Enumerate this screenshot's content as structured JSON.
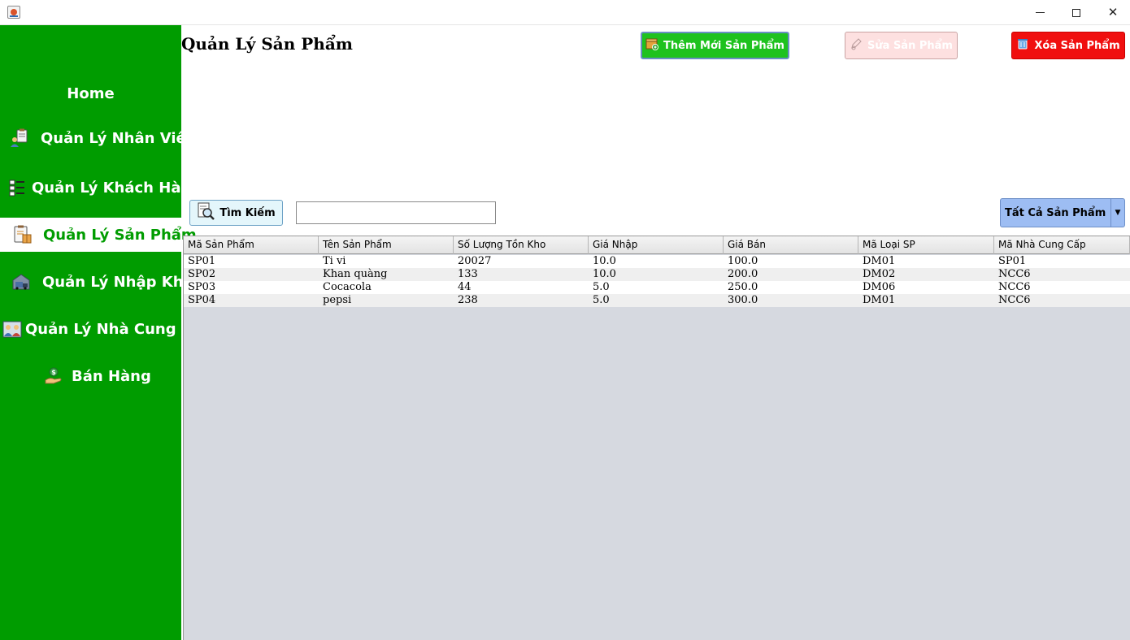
{
  "window": {
    "app_icon": "java-cup-icon"
  },
  "sidebar": {
    "home_label": "Home",
    "items": [
      {
        "label": "Quản Lý Nhân Viên",
        "icon": "employee-clipboard-icon"
      },
      {
        "label": "Quản Lý Khách Hàng",
        "icon": "customer-list-icon"
      },
      {
        "label": "Quản Lý Sản Phẩm",
        "icon": "product-clipboard-icon",
        "active": true
      },
      {
        "label": "Quản Lý Nhập Kho",
        "icon": "warehouse-truck-icon"
      },
      {
        "label": "Quản Lý Nhà Cung Cấp",
        "icon": "supplier-group-icon"
      },
      {
        "label": "Bán Hàng",
        "icon": "sale-hand-icon"
      }
    ],
    "colors": {
      "background": "#009c00",
      "active_background": "#ffffff"
    }
  },
  "header": {
    "title": "Quản Lý Sản Phẩm",
    "add_button": "Thêm Mới Sản Phẩm",
    "edit_button": "Sửa Sản Phẩm",
    "delete_button": "Xóa Sản Phẩm",
    "colors": {
      "add": "#1ec21e",
      "edit": "#fde0e0",
      "delete": "#f00f0f"
    }
  },
  "search": {
    "button_label": "Tìm Kiếm",
    "input_value": "",
    "filter_selected": "Tất Cả Sản Phẩm"
  },
  "table": {
    "columns": [
      "Mã Sản Phẩm",
      "Tên Sản Phẩm",
      "Số Lượng Tồn Kho",
      "Giá Nhập",
      "Giá Bán",
      "Mã Loại SP",
      "Mã Nhà Cung Cấp"
    ],
    "rows": [
      [
        "SP01",
        "Ti vi",
        "20027",
        "10.0",
        "100.0",
        "DM01",
        "SP01"
      ],
      [
        "SP02",
        "Khan quàng",
        "133",
        "10.0",
        "200.0",
        "DM02",
        "NCC6"
      ],
      [
        "SP03",
        "Cocacola",
        "44",
        "5.0",
        "250.0",
        "DM06",
        "NCC6"
      ],
      [
        "SP04",
        "pepsi",
        "238",
        "5.0",
        "300.0",
        "DM01",
        "NCC6"
      ]
    ]
  }
}
